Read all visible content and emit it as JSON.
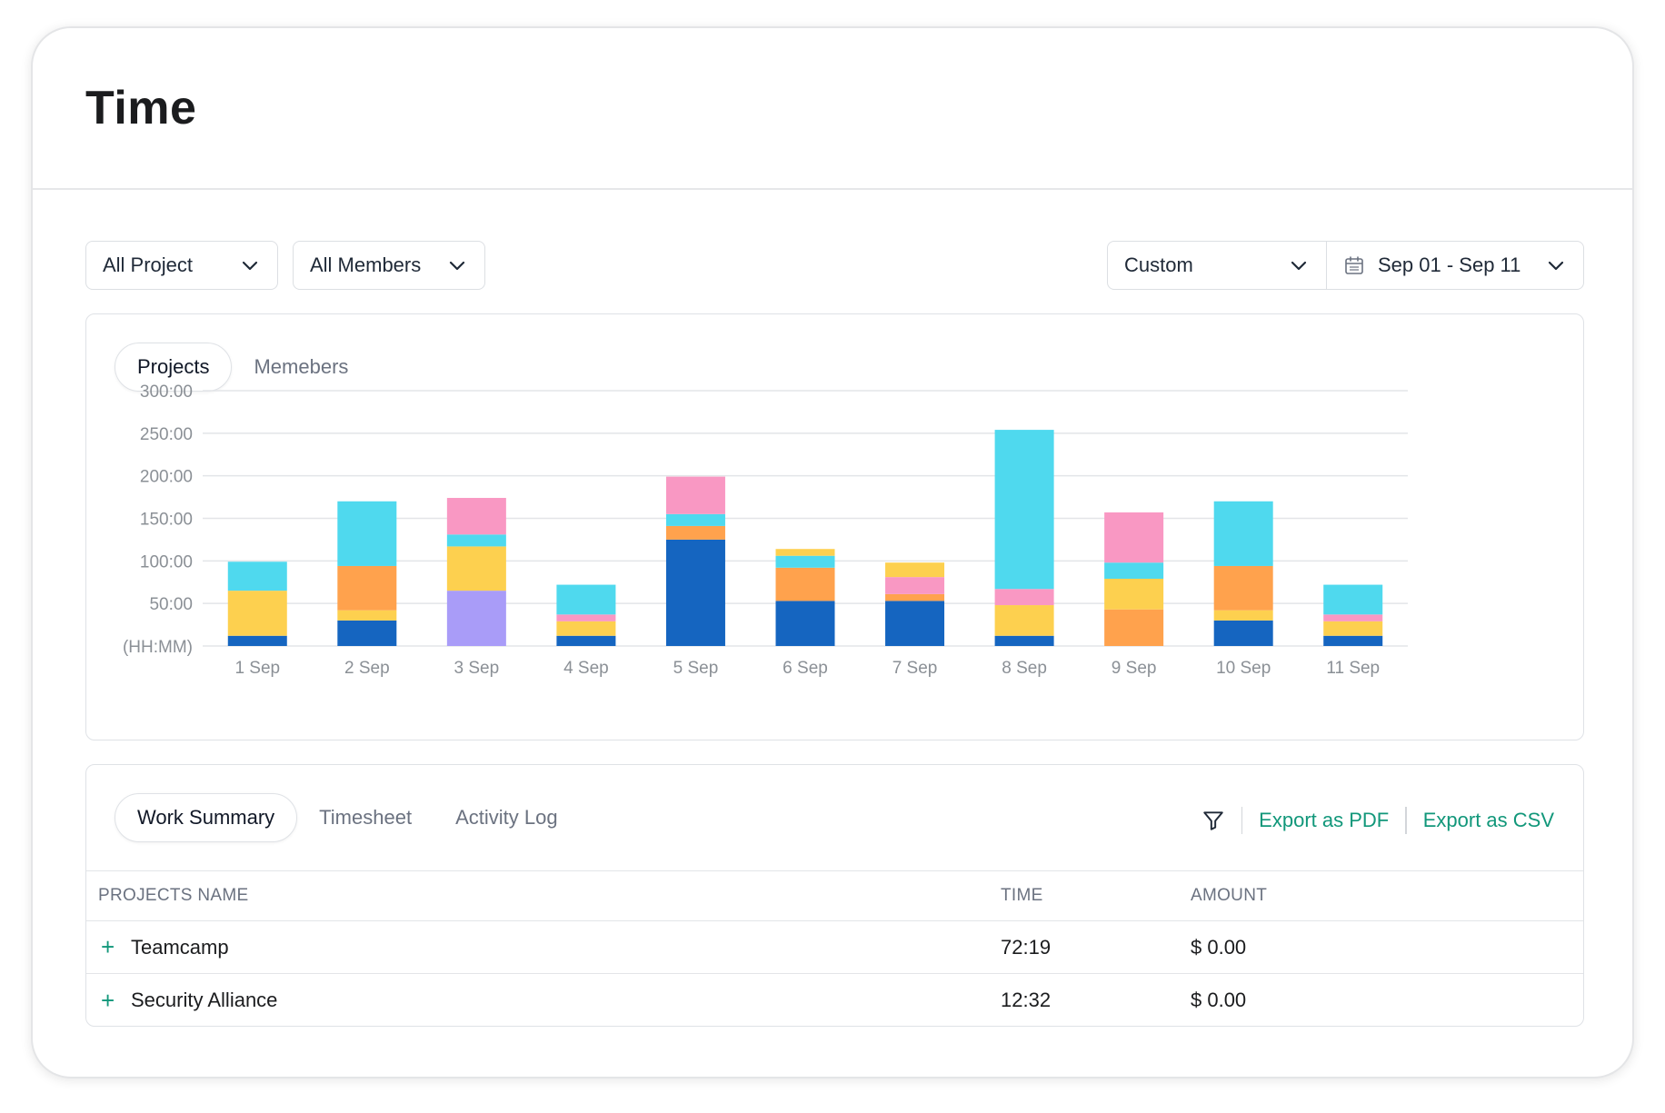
{
  "page": {
    "title": "Time"
  },
  "filters": {
    "project": "All Project",
    "members": "All Members",
    "period": "Custom",
    "date_range": "Sep 01 - Sep 11"
  },
  "chart_tabs": [
    {
      "label": "Projects",
      "active": true
    },
    {
      "label": "Memebers",
      "active": false
    }
  ],
  "chart_data": {
    "type": "bar",
    "stacked": true,
    "ylim": [
      0,
      300
    ],
    "y_ticks": [
      "(HH:MM)",
      "50:00",
      "100:00",
      "150:00",
      "200:00",
      "250:00",
      "300:00"
    ],
    "grid": true,
    "categories": [
      "1 Sep",
      "2 Sep",
      "3 Sep",
      "4 Sep",
      "5 Sep",
      "6 Sep",
      "7 Sep",
      "8 Sep",
      "9 Sep",
      "10 Sep",
      "11 Sep"
    ],
    "series": [
      {
        "color": "#1565c0",
        "values": [
          12,
          30,
          0,
          12,
          125,
          53,
          53,
          12,
          0,
          30,
          12
        ]
      },
      {
        "color": "#a99cf8",
        "values": [
          0,
          0,
          65,
          0,
          0,
          0,
          0,
          0,
          0,
          0,
          0
        ]
      },
      {
        "color": "#ffa24d",
        "values": [
          0,
          0,
          0,
          0,
          16,
          0,
          8,
          0,
          43,
          0,
          0
        ]
      },
      {
        "color": "#fdd04f",
        "values": [
          53,
          12,
          52,
          17,
          0,
          0,
          0,
          36,
          36,
          12,
          17
        ]
      },
      {
        "color": "#ffa24d",
        "values": [
          0,
          52,
          0,
          0,
          0,
          39,
          0,
          0,
          0,
          52,
          0
        ]
      },
      {
        "color": "#f998c3",
        "values": [
          0,
          0,
          0,
          8,
          0,
          0,
          20,
          19,
          0,
          0,
          8
        ]
      },
      {
        "color": "#4fd9ee",
        "values": [
          34,
          76,
          14,
          35,
          14,
          14,
          0,
          187,
          19,
          76,
          35
        ]
      },
      {
        "color": "#f998c3",
        "values": [
          0,
          0,
          43,
          0,
          44,
          0,
          0,
          0,
          59,
          0,
          0
        ]
      },
      {
        "color": "#fdd04f",
        "values": [
          0,
          0,
          0,
          0,
          0,
          8,
          17,
          0,
          0,
          0,
          0
        ]
      }
    ]
  },
  "table_tabs": [
    {
      "label": "Work Summary",
      "active": true
    },
    {
      "label": "Timesheet",
      "active": false
    },
    {
      "label": "Activity Log",
      "active": false
    }
  ],
  "actions": {
    "export_pdf": "Export as PDF",
    "export_csv": "Export as CSV"
  },
  "table": {
    "headers": {
      "name": "PROJECTS NAME",
      "time": "TIME",
      "amount": "AMOUNT"
    },
    "rows": [
      {
        "expand": "+",
        "name": "Teamcamp",
        "time": "72:19",
        "amount": "$ 0.00"
      },
      {
        "expand": "+",
        "name": "Security Alliance",
        "time": "12:32",
        "amount": "$ 0.00"
      }
    ]
  },
  "colors": {
    "accent": "#11977a"
  }
}
